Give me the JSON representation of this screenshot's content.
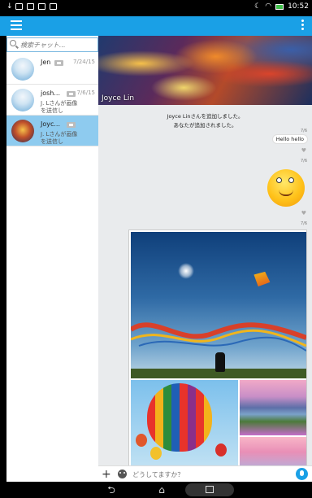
{
  "status_bar": {
    "time": "10:52"
  },
  "sidebar": {
    "search_placeholder": "検索チャット...",
    "chats": [
      {
        "name": "Jen",
        "date": "7/24/15",
        "preview": "",
        "selected": false
      },
      {
        "name": "josh...",
        "date": "7/6/15",
        "preview": "J. Lさんが画像を送信し",
        "selected": false
      },
      {
        "name": "Joyc...",
        "date": "",
        "preview": "J. Lさんが画像を送信し",
        "selected": true
      }
    ]
  },
  "conversation": {
    "title": "Joyce Lin",
    "system_messages": [
      "Joyce Linさんを追加しました。",
      "あなたが追加されました。"
    ],
    "timestamps": [
      "7/6",
      "7/6",
      "7/6"
    ],
    "messages": [
      {
        "type": "text",
        "text": "Hello hello"
      },
      {
        "type": "sticker",
        "icon": "smiley-sticker"
      },
      {
        "type": "photos",
        "icons": [
          "kite-photo",
          "balloon-photo",
          "lake-photo",
          "sky-photo"
        ]
      }
    ]
  },
  "composer": {
    "placeholder": "どうしてますか？"
  },
  "colors": {
    "accent": "#1aa0e6",
    "selected": "#8ecbef",
    "background": "#e9ebed"
  }
}
